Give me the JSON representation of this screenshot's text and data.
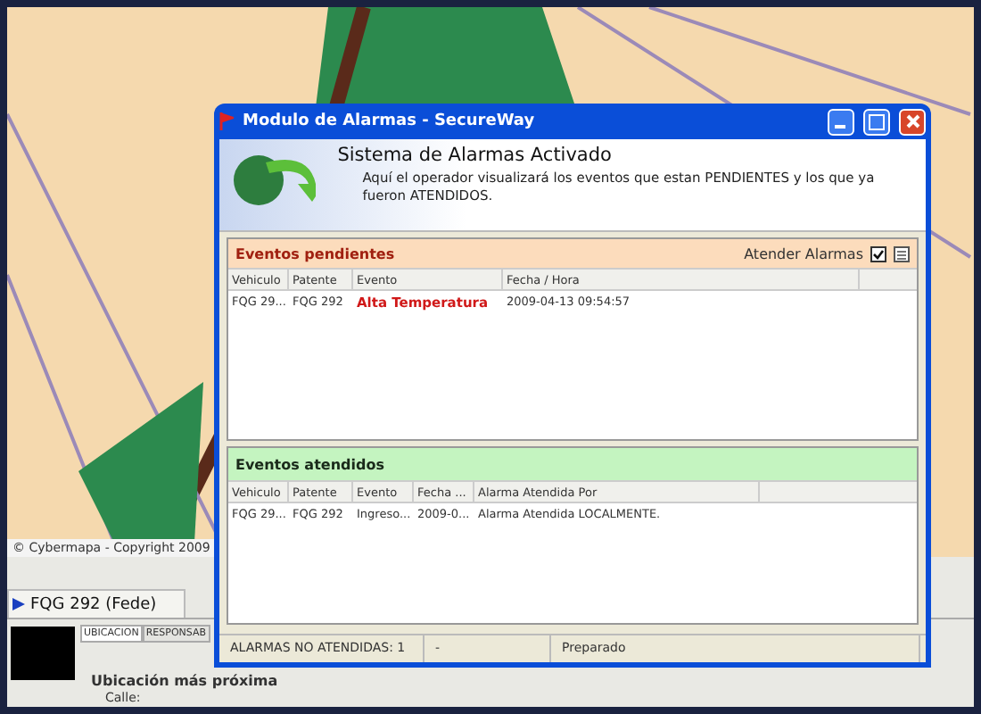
{
  "map": {
    "copyright": "© Cybermapa - Copyright 2009"
  },
  "app": {
    "vehicle_tab": "FQG 292 (Fede)",
    "tabs": [
      {
        "label": "UBICACION",
        "selected": true
      },
      {
        "label": "RESPONSAB",
        "selected": false
      }
    ],
    "group_title": "Ubicación más próxima",
    "field_label": "Calle:"
  },
  "window": {
    "title": "Modulo de Alarmas - SecureWay",
    "heading": "Sistema de Alarmas Activado",
    "description": "Aquí el operador visualizará los eventos que estan PENDIENTES y los que ya fueron ATENDIDOS.",
    "pending": {
      "title": "Eventos pendientes",
      "action_label": "Atender Alarmas",
      "action_checked": true,
      "columns": [
        "Vehiculo",
        "Patente",
        "Evento",
        "Fecha / Hora"
      ],
      "rows": [
        {
          "cells": [
            "FQG 29...",
            "FQG 292",
            "Alta Temperatura",
            "2009-04-13 09:54:57"
          ],
          "alert": true
        }
      ]
    },
    "attended": {
      "title": "Eventos atendidos",
      "columns": [
        "Vehiculo",
        "Patente",
        "Evento",
        "Fecha ...",
        "Alarma Atendida Por"
      ],
      "rows": [
        {
          "cells": [
            "FQG 29...",
            "FQG 292",
            "Ingreso...",
            "2009-0...",
            "Alarma Atendida LOCALMENTE."
          ],
          "alert": false
        }
      ]
    },
    "status_bar": [
      "ALARMAS NO ATENDIDAS: 1",
      "-",
      "Preparado"
    ]
  }
}
